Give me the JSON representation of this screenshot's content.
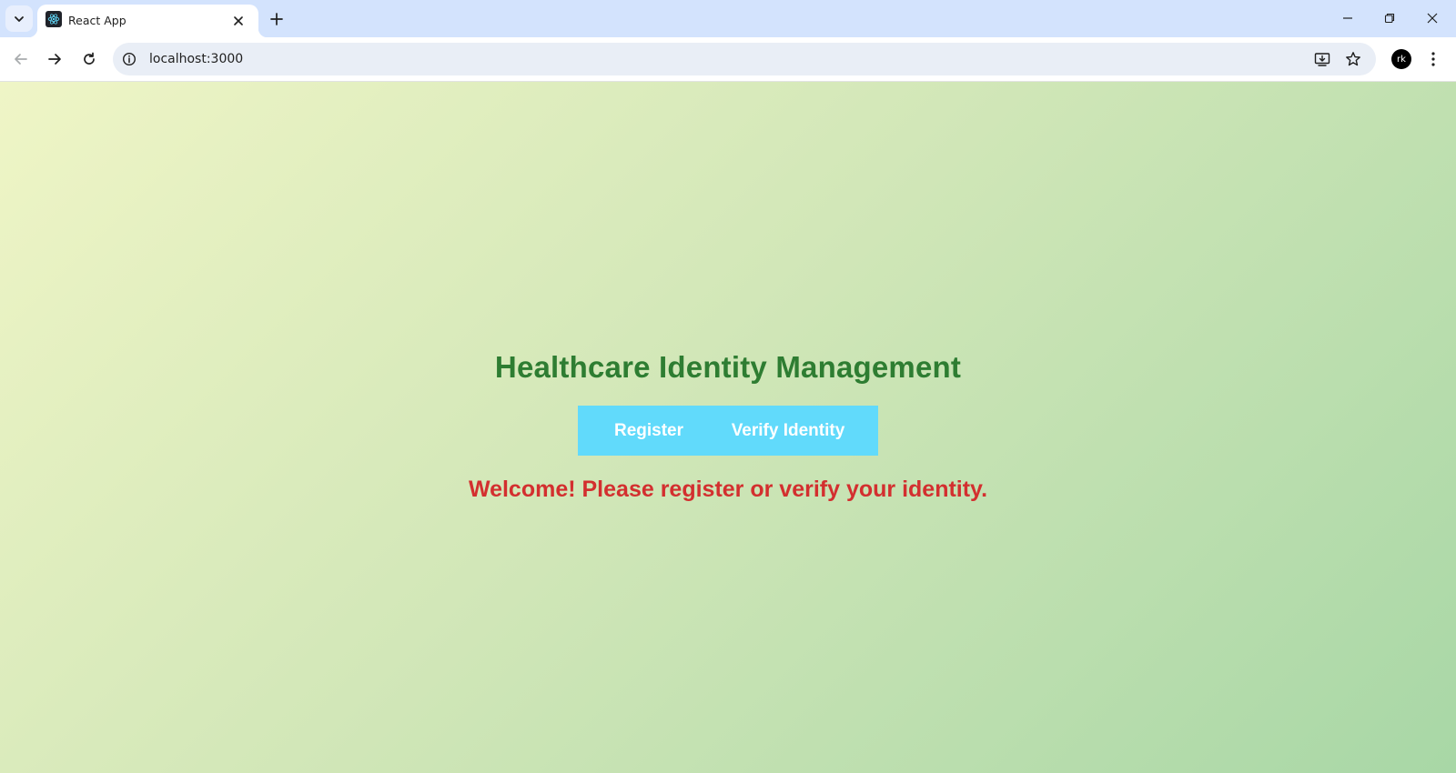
{
  "browser": {
    "tab": {
      "title": "React App",
      "favicon": "react-logo-icon"
    },
    "address_bar": {
      "url": "localhost:3000"
    },
    "profile_initials": "rk",
    "icons": {
      "tab_search": "chevron-down-icon",
      "tab_close": "close-icon",
      "new_tab": "plus-icon",
      "back": "arrow-left-icon",
      "forward": "arrow-right-icon",
      "reload": "reload-icon",
      "site_info": "info-icon",
      "install_app": "install-app-icon",
      "bookmark": "star-icon",
      "menu": "kebab-menu-icon",
      "minimize": "minimize-icon",
      "restore": "restore-icon",
      "close_window": "close-icon"
    }
  },
  "app": {
    "title": "Healthcare Identity Management",
    "buttons": {
      "register": "Register",
      "verify": "Verify Identity"
    },
    "message": "Welcome! Please register or verify your identity."
  },
  "colors": {
    "title": "#2e7d32",
    "button_background": "#61dafb",
    "button_text": "#ffffff",
    "message": "#d32f2f",
    "background_gradient": [
      "#eff5c6",
      "#a8d7a6"
    ]
  }
}
